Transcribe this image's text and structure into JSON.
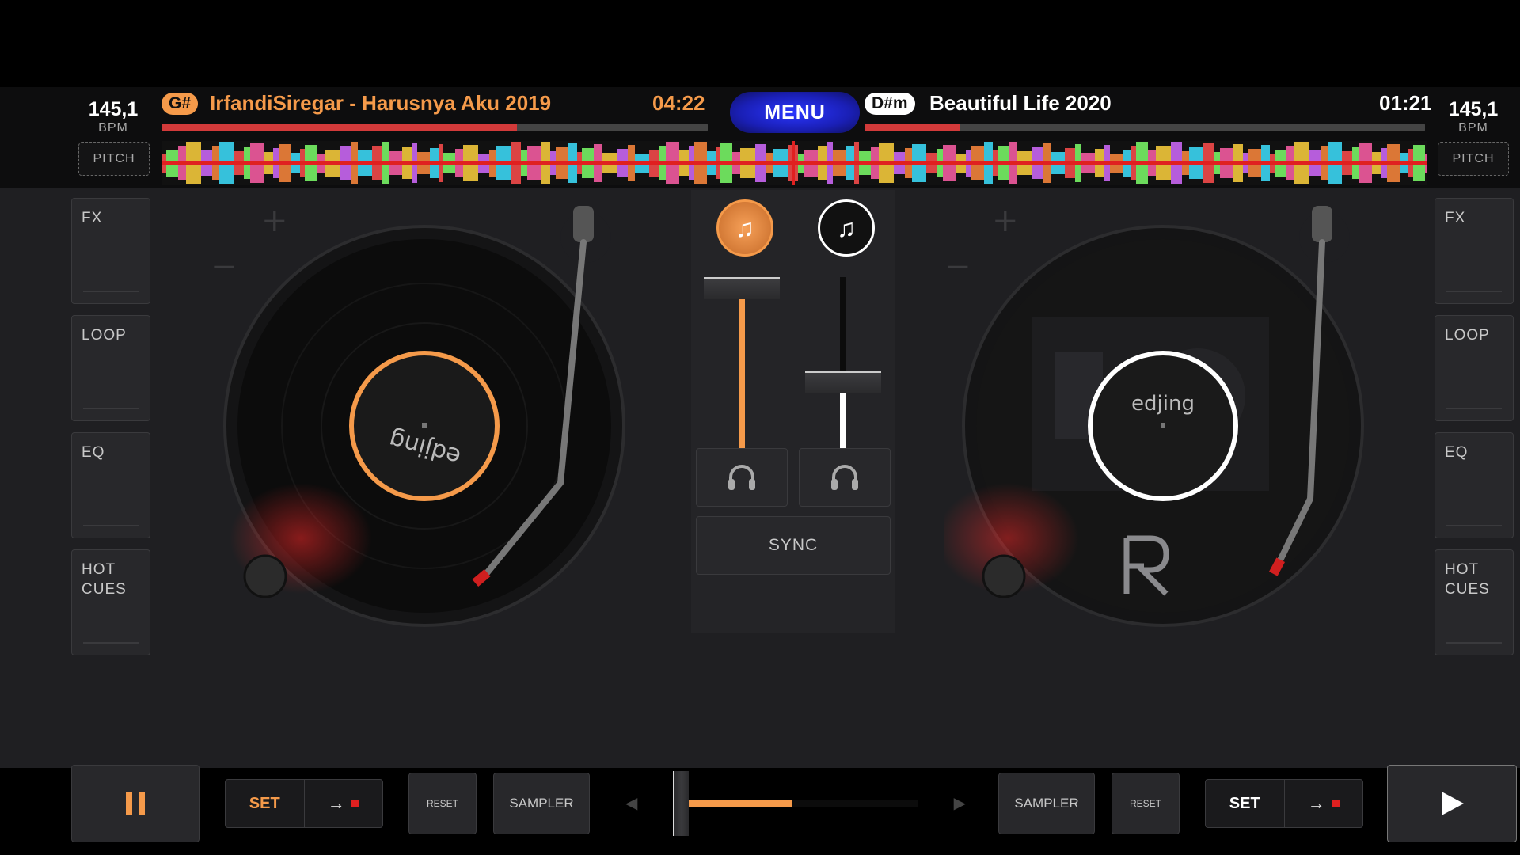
{
  "deck_left": {
    "bpm": "145,1",
    "bpm_label": "BPM",
    "pitch_label": "PITCH",
    "key": "G#",
    "title": "IrfandiSiregar - Harusnya Aku 2019",
    "time": "04:22",
    "progress": 0.65,
    "accent_color": "#f59a4a",
    "label_text": "edjing",
    "panels": [
      "FX",
      "LOOP",
      "EQ",
      "HOT\nCUES"
    ],
    "set_label": "SET",
    "reset_label": "RESET",
    "sampler_label": "SAMPLER",
    "play_state": "pause"
  },
  "deck_right": {
    "bpm": "145,1",
    "bpm_label": "BPM",
    "pitch_label": "PITCH",
    "key": "D#m",
    "title": "Beautiful Life 2020",
    "time": "01:21",
    "progress": 0.17,
    "accent_color": "#ffffff",
    "label_text": "edjing",
    "panels": [
      "FX",
      "LOOP",
      "EQ",
      "HOT\nCUES"
    ],
    "set_label": "SET",
    "reset_label": "RESET",
    "sampler_label": "SAMPLER",
    "play_state": "play"
  },
  "menu_label": "MENU",
  "mixer": {
    "sync_label": "SYNC",
    "volume_left": 1.0,
    "volume_right": 0.55
  },
  "crossfader": {
    "position": 0.0
  },
  "icons": {
    "load_track": "music-note-plus-icon",
    "headphones": "headphones-icon",
    "arrow": "arrow-right-icon"
  }
}
